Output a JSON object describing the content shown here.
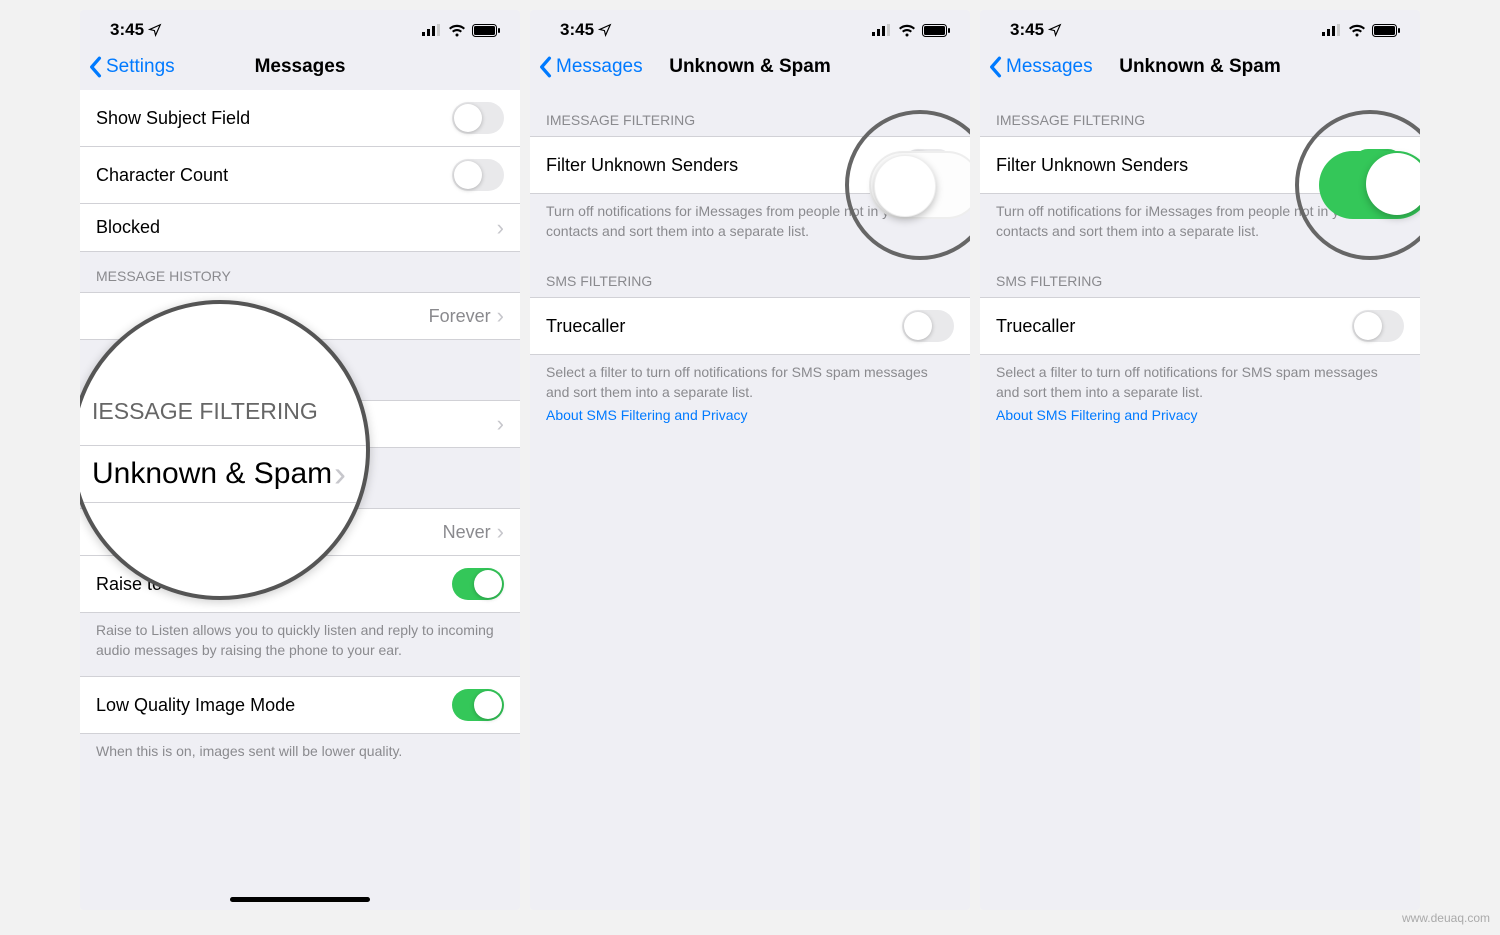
{
  "status": {
    "time": "3:45",
    "location_arrow": "➤"
  },
  "screen1": {
    "back": "Settings",
    "title": "Messages",
    "rows": {
      "show_subject": "Show Subject Field",
      "char_count": "Character Count",
      "blocked": "Blocked",
      "forever": "Forever",
      "never": "Never",
      "raise_to_listen": "Raise to Listen",
      "low_quality": "Low Quality Image Mode"
    },
    "headers": {
      "history": "MESSAGE HISTORY"
    },
    "footers": {
      "raise": "Raise to Listen allows you to quickly listen and reply to incoming audio messages by raising the phone to your ear.",
      "lowq": "When this is on, images sent will be lower quality."
    },
    "magnifier": {
      "header": "IESSAGE FILTERING",
      "row": "Unknown & Spam"
    }
  },
  "screen2": {
    "back": "Messages",
    "title": "Unknown & Spam",
    "headers": {
      "imsg": "IMESSAGE FILTERING",
      "sms": "SMS FILTERING"
    },
    "rows": {
      "filter": "Filter Unknown Senders",
      "truecaller": "Truecaller"
    },
    "footers": {
      "filter": "Turn off notifications for iMessages from people not in your contacts and sort them into a separate list.",
      "sms": "Select a filter to turn off notifications for SMS spam messages and sort them into a separate list.",
      "sms_link": "About SMS Filtering and Privacy"
    }
  },
  "watermark": "www.deuaq.com"
}
